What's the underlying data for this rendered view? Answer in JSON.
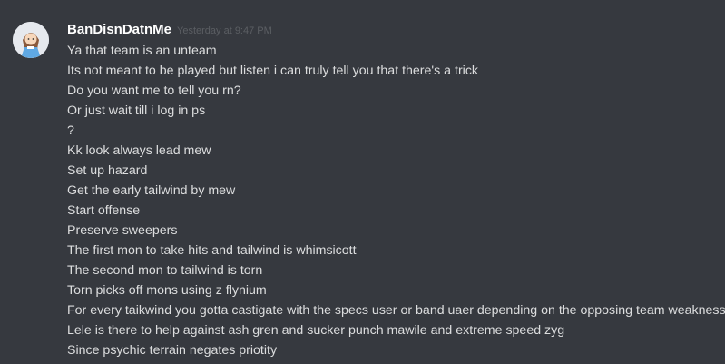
{
  "message": {
    "username": "BanDisnDatnMe",
    "timestamp": "Yesterday at 9:47 PM",
    "avatar_icon": "user-avatar-icon",
    "colors": {
      "background": "#36393f",
      "username": "#ffffff",
      "timestamp": "#5b5e63",
      "text": "#dcddde"
    },
    "lines": [
      "Ya that team is an unteam",
      "Its not meant to be played but listen i can truly tell you that there's a trick",
      "Do you want me to tell you rn?",
      "Or just wait till i log in ps",
      "?",
      "Kk look always lead mew",
      "Set up hazard",
      "Get the early tailwind by mew",
      "Start offense",
      "Preserve sweepers",
      "The first mon to take hits and tailwind is whimsicott",
      "The second mon to tailwind is torn",
      "Torn picks off mons using z flynium",
      "For every taikwind you gotta castigate with the specs user or band uaer depending on the opposing team weakness",
      "Lele is there to help against ash gren and sucker punch mawile and extreme speed zyg",
      "Since psychic terrain negates priotity"
    ]
  }
}
